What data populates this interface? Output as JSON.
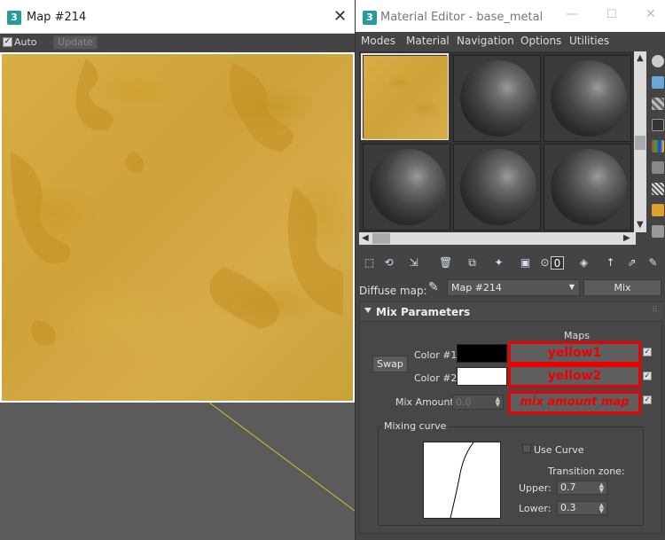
{
  "map_window": {
    "title": "Map #214",
    "auto_label": "Auto",
    "update_label": "Update",
    "close_glyph": "✕"
  },
  "material_editor": {
    "title": "Material Editor - base_metal",
    "menu": [
      "Modes",
      "Material",
      "Navigation",
      "Options",
      "Utilities"
    ],
    "diffuse_label": "Diffuse map:",
    "map_dropdown": "Map #214",
    "map_type_button": "Mix",
    "rollout_title": "Mix Parameters",
    "maps_header": "Maps",
    "swap_label": "Swap",
    "color1_label": "Color #1",
    "color2_label": "Color #2",
    "mix_amount_label": "Mix Amount:",
    "mix_amount_value": "0.0",
    "map1_label": "yellow1",
    "map2_label": "yellow2",
    "map3_label": "mix amount map",
    "color1_hex": "#000000",
    "color2_hex": "#ffffff",
    "mixing_curve_label": "Mixing curve",
    "use_curve_label": "Use Curve",
    "transition_zone_label": "Transition zone:",
    "upper_label": "Upper:",
    "upper_value": "0.7",
    "lower_label": "Lower:",
    "lower_value": "0.3"
  },
  "icons": {
    "app": "3ds-max-icon",
    "accent": "#2a9b9b",
    "highlight": "#ee0000"
  }
}
